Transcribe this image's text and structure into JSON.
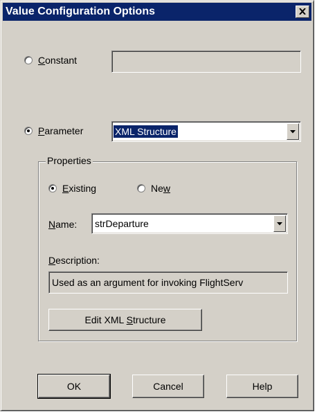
{
  "dialog": {
    "title": "Value Configuration Options"
  },
  "constant": {
    "label_mnemonic": "C",
    "label_rest": "onstant",
    "value": ""
  },
  "parameter": {
    "label_mnemonic": "P",
    "label_rest": "arameter",
    "selected_type": "XML Structure"
  },
  "properties": {
    "legend": "Properties",
    "existing_mnemonic": "E",
    "existing_rest": "xisting",
    "new_prefix": "Ne",
    "new_mnemonic": "w",
    "name_mnemonic": "N",
    "name_rest": "ame:",
    "name_value": "strDeparture",
    "description_mnemonic": "D",
    "description_rest": "escription:",
    "description_value": "Used as an argument for invoking FlightServ",
    "edit_button_prefix": "Edit XML ",
    "edit_button_mnemonic": "S",
    "edit_button_rest": "tructure"
  },
  "buttons": {
    "ok": "OK",
    "cancel": "Cancel",
    "help": "Help"
  },
  "state": {
    "mode": "parameter",
    "parameter_source": "existing"
  },
  "icons": {
    "close": "close-icon",
    "dropdown": "chevron-down-icon"
  }
}
